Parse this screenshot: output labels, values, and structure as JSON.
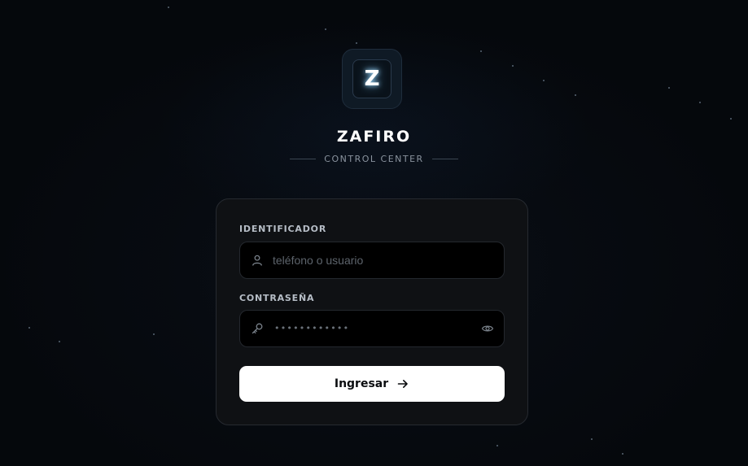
{
  "brand": {
    "logo_letter": "Z",
    "title": "ZAFIRO",
    "subtitle": "CONTROL CENTER"
  },
  "form": {
    "identifier": {
      "label": "IDENTIFICADOR",
      "placeholder": "teléfono o usuario",
      "icon": "user-icon"
    },
    "password": {
      "label": "CONTRASEÑA",
      "masked_value": "••••••••••••",
      "icon": "key-icon",
      "toggle_icon": "eye-icon"
    },
    "submit": {
      "label": "Ingresar",
      "icon": "arrow-right-icon"
    }
  },
  "colors": {
    "background": "#05080c",
    "card": "#0f1114",
    "button": "#ffffff",
    "logo_glow": "#9fdcff"
  }
}
